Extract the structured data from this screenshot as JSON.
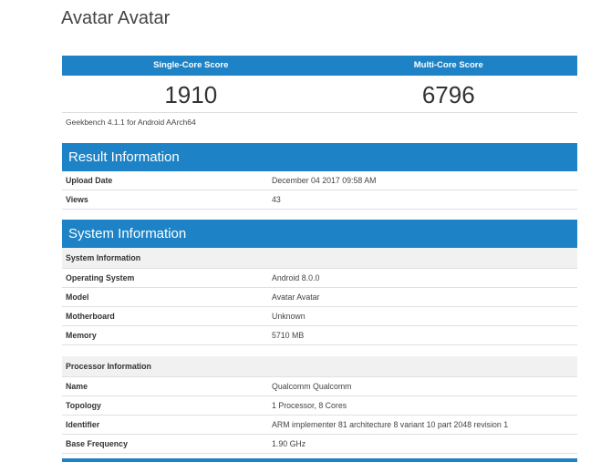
{
  "page": {
    "title": "Avatar Avatar"
  },
  "scores": {
    "single_label": "Single-Core Score",
    "multi_label": "Multi-Core Score",
    "single_value": "1910",
    "multi_value": "6796"
  },
  "version": "Geekbench 4.1.1 for Android AArch64",
  "result": {
    "heading": "Result Information",
    "rows": [
      {
        "label": "Upload Date",
        "value": "December 04 2017 09:58 AM"
      },
      {
        "label": "Views",
        "value": "43"
      }
    ]
  },
  "system": {
    "heading": "System Information",
    "sub1": "System Information",
    "rows1": [
      {
        "label": "Operating System",
        "value": "Android 8.0.0"
      },
      {
        "label": "Model",
        "value": "Avatar Avatar"
      },
      {
        "label": "Motherboard",
        "value": "Unknown"
      },
      {
        "label": "Memory",
        "value": "5710 MB"
      }
    ],
    "sub2": "Processor Information",
    "rows2": [
      {
        "label": "Name",
        "value": "Qualcomm Qualcomm"
      },
      {
        "label": "Topology",
        "value": "1 Processor, 8 Cores"
      },
      {
        "label": "Identifier",
        "value": "ARM implementer 81 architecture 8 variant 10 part 2048 revision 1"
      },
      {
        "label": "Base Frequency",
        "value": "1.90 GHz"
      }
    ]
  }
}
